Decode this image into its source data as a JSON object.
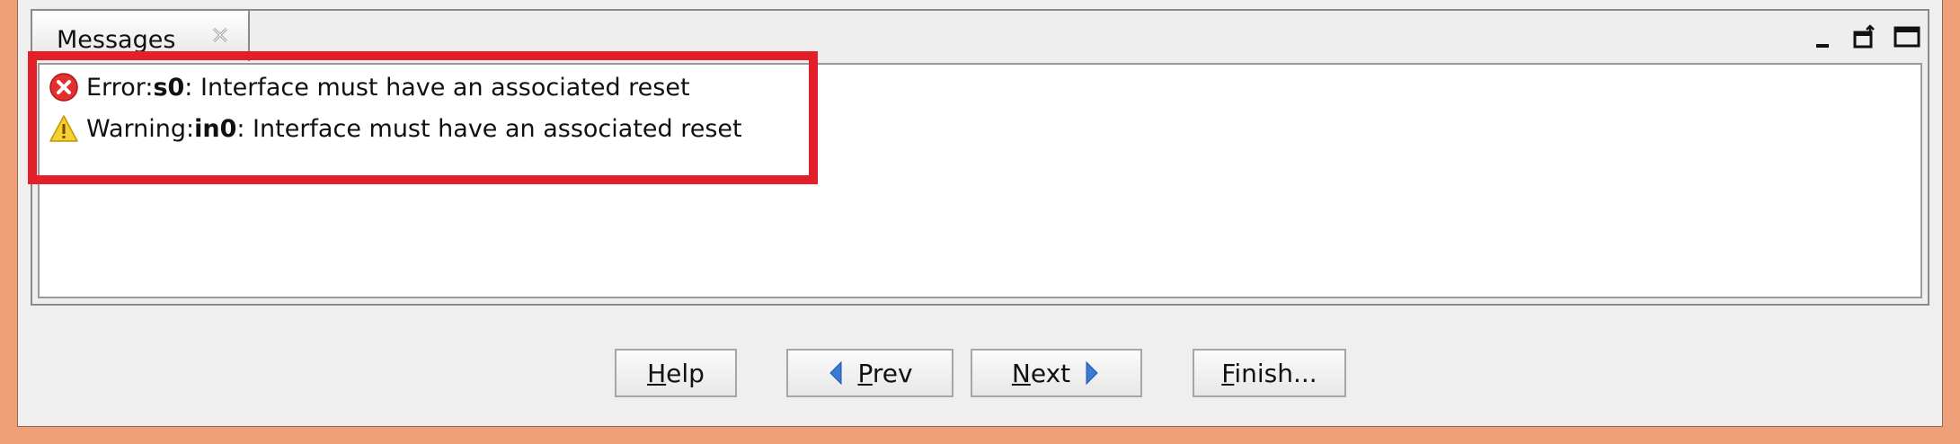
{
  "messages_view": {
    "tab_label": "Messages",
    "messages": [
      {
        "type": "error",
        "icon": "error-icon",
        "prefix": "Error: ",
        "subject": "s0",
        "text": ": Interface must have an associated reset"
      },
      {
        "type": "warning",
        "icon": "warning-icon",
        "prefix": "Warning: ",
        "subject": "in0",
        "text": ": Interface must have an associated reset"
      }
    ]
  },
  "buttons": {
    "help": {
      "mnemonic": "H",
      "rest": "elp"
    },
    "prev": {
      "mnemonic": "P",
      "rest": "rev"
    },
    "next": {
      "mnemonic": "N",
      "rest": "ext"
    },
    "finish": {
      "mnemonic": "F",
      "rest": "inish..."
    }
  },
  "colors": {
    "outer_frame": "#f0a078",
    "highlight": "#e3202a",
    "error": "#e3302f",
    "warning": "#f2c200",
    "arrow": "#3b7bd6"
  }
}
